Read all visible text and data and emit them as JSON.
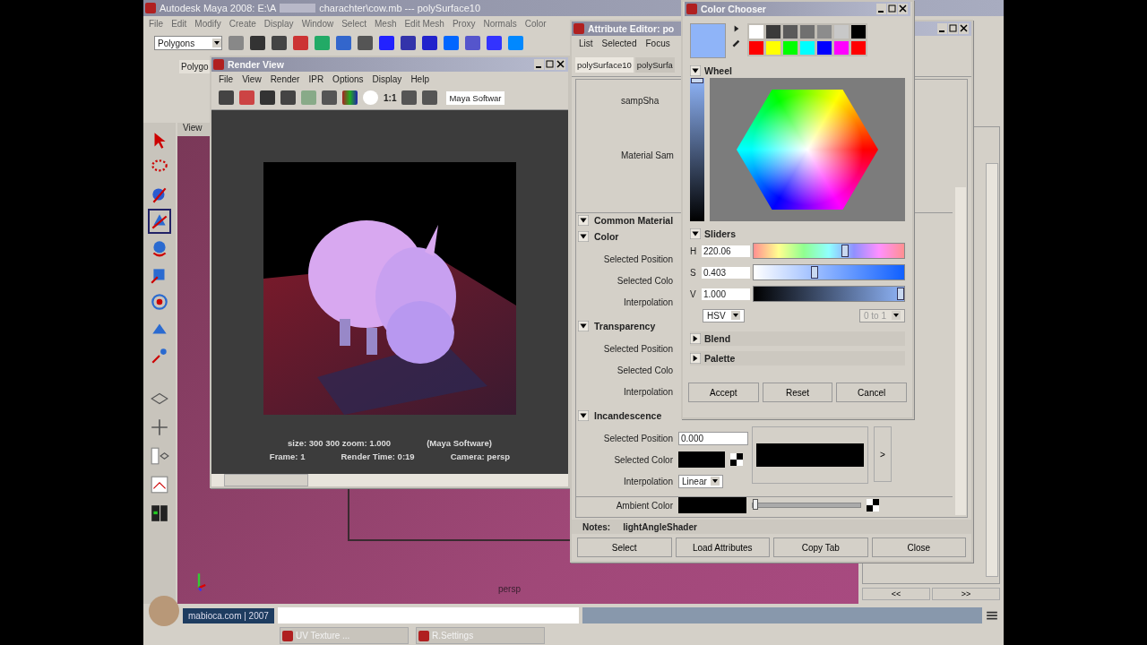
{
  "main_window": {
    "title_path": "Autodesk Maya 2008: E:\\A",
    "title_rest": "charachter\\cow.mb  ---  polySurface10",
    "menus": [
      "File",
      "Edit",
      "Modify",
      "Create",
      "Display",
      "Window",
      "Select",
      "Mesh",
      "Edit Mesh",
      "Proxy",
      "Normals",
      "Color"
    ],
    "mode_dropdown": "Polygons",
    "shelf_tab": "Polygo",
    "view_menu": "View",
    "viewport_label": "persp",
    "timeline_buttons": [
      "<<",
      ">>"
    ]
  },
  "render_view": {
    "title": "Render View",
    "menus": [
      "File",
      "View",
      "Render",
      "IPR",
      "Options",
      "Display",
      "Help"
    ],
    "zoom_button": "1:1",
    "renderer": "Maya Softwar",
    "stats": [
      "size:  300  300 zoom: 1.000",
      "(Maya Software)",
      "Frame: 1",
      "Render Time: 0:19",
      "Camera: persp"
    ]
  },
  "attribute_editor": {
    "title": "Attribute Editor: po",
    "menus": [
      "List",
      "Selected",
      "Focus"
    ],
    "tabs": [
      {
        "label": "polySurface10",
        "selected": true
      },
      {
        "label": "polySurfa",
        "selected": false
      }
    ],
    "top_labels": [
      "sampSha",
      "Material Sam"
    ],
    "sections": [
      {
        "label": "Common Material",
        "expanded": true,
        "kind": "header"
      },
      {
        "label": "Color",
        "expanded": true,
        "kind": "ramp",
        "rows": [
          {
            "label": "Selected Position"
          },
          {
            "label": "Selected Colo"
          },
          {
            "label": "Interpolation"
          }
        ]
      },
      {
        "label": "Transparency",
        "expanded": true,
        "kind": "ramp",
        "rows": [
          {
            "label": "Selected Position"
          },
          {
            "label": "Selected Colo"
          },
          {
            "label": "Interpolation"
          }
        ]
      },
      {
        "label": "Incandescence",
        "expanded": true,
        "kind": "ramp",
        "rows": [
          {
            "label": "Selected Position",
            "kind": "field",
            "value": "0.000"
          },
          {
            "label": "Selected Color",
            "kind": "swatch"
          },
          {
            "label": "Interpolation",
            "kind": "dropdown",
            "value": "Linear"
          }
        ],
        "ramp_button": ">"
      }
    ],
    "ambient_label": "Ambient Color",
    "ambient_slider": {
      "level": 0
    },
    "notes_label": "Notes:",
    "notes_value": "lightAngleShader",
    "buttons": [
      "Select",
      "Load Attributes",
      "Copy Tab",
      "Close"
    ]
  },
  "color_chooser": {
    "title": "Color Chooser",
    "swatches": [
      {
        "color": "#ffffff"
      },
      {
        "color": "#3a3a3a"
      },
      {
        "color": "#5a5a5a"
      },
      {
        "color": "#707070"
      },
      {
        "color": "#8c8c8c"
      },
      {
        "color": "#c8c8c8"
      },
      {
        "color": "#000000"
      },
      {
        "color": "#ff0000"
      },
      {
        "color": "#ffff00"
      },
      {
        "color": "#00ff00"
      },
      {
        "color": "#00ffff"
      },
      {
        "color": "#0000ff"
      },
      {
        "color": "#ff00ff"
      },
      {
        "color": "#ff0000"
      }
    ],
    "wheel_label": "Wheel",
    "wheel_expanded": true,
    "value_slider": {
      "level": 1
    },
    "sliders_label": "Sliders",
    "sliders_expanded": true,
    "sliders": [
      {
        "label": "H",
        "value": "220.06",
        "level": 0.61,
        "kind": "hue"
      },
      {
        "label": "S",
        "value": "0.403",
        "level": 0.403,
        "kind": "saturation"
      },
      {
        "label": "V",
        "value": "1.000",
        "level": 1.0,
        "kind": "value"
      }
    ],
    "mode": "HSV",
    "range": "0 to 1",
    "range_disabled": true,
    "collapsed_sections": [
      {
        "label": "Blend",
        "expanded": false
      },
      {
        "label": "Palette",
        "expanded": false
      }
    ],
    "buttons": [
      "Accept",
      "Reset",
      "Cancel"
    ]
  },
  "status": {
    "credit": "mabioca.com | 2007"
  },
  "taskbar": [
    {
      "label": "UV Texture ..."
    },
    {
      "label": "R.Settings"
    }
  ]
}
